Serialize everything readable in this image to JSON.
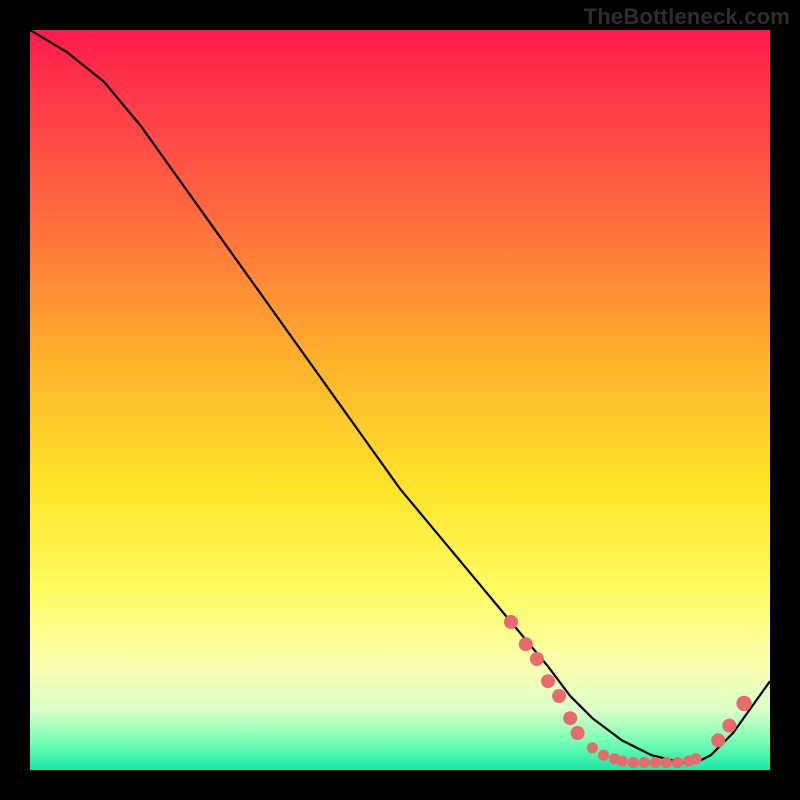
{
  "attribution": "TheBottleneck.com",
  "chart_data": {
    "type": "line",
    "title": "",
    "xlabel": "",
    "ylabel": "",
    "xlim": [
      0,
      100
    ],
    "ylim": [
      0,
      100
    ],
    "legend": false,
    "grid": false,
    "series": [
      {
        "name": "curve",
        "x": [
          0,
          5,
          10,
          15,
          20,
          25,
          30,
          35,
          40,
          45,
          50,
          55,
          60,
          65,
          70,
          73,
          76,
          80,
          84,
          88,
          90,
          92,
          95,
          100
        ],
        "y": [
          100,
          97,
          93,
          87,
          80,
          73,
          66,
          59,
          52,
          45,
          38,
          32,
          26,
          20,
          14,
          10,
          7,
          4,
          2,
          1,
          1,
          2,
          5,
          12
        ]
      }
    ],
    "markers": [
      {
        "x": 65,
        "y": 20,
        "r": 1.0
      },
      {
        "x": 67,
        "y": 17,
        "r": 1.0
      },
      {
        "x": 68.5,
        "y": 15,
        "r": 1.0
      },
      {
        "x": 70,
        "y": 12,
        "r": 1.0
      },
      {
        "x": 71.5,
        "y": 10,
        "r": 1.0
      },
      {
        "x": 73,
        "y": 7,
        "r": 1.0
      },
      {
        "x": 74,
        "y": 5,
        "r": 1.0
      },
      {
        "x": 76,
        "y": 3,
        "r": 0.8
      },
      {
        "x": 77.5,
        "y": 2,
        "r": 0.8
      },
      {
        "x": 79,
        "y": 1.5,
        "r": 0.8
      },
      {
        "x": 80,
        "y": 1.2,
        "r": 0.8
      },
      {
        "x": 81.5,
        "y": 1,
        "r": 0.8
      },
      {
        "x": 83,
        "y": 1,
        "r": 0.8
      },
      {
        "x": 84.5,
        "y": 1,
        "r": 0.8
      },
      {
        "x": 86,
        "y": 1,
        "r": 0.8
      },
      {
        "x": 87.5,
        "y": 1,
        "r": 0.8
      },
      {
        "x": 89,
        "y": 1.2,
        "r": 0.8
      },
      {
        "x": 90,
        "y": 1.5,
        "r": 0.8
      },
      {
        "x": 93,
        "y": 4,
        "r": 1.0
      },
      {
        "x": 94.5,
        "y": 6,
        "r": 1.0
      },
      {
        "x": 96.5,
        "y": 9,
        "r": 1.1
      }
    ],
    "marker_color": "#e86a6a",
    "line_color": "#000000"
  }
}
